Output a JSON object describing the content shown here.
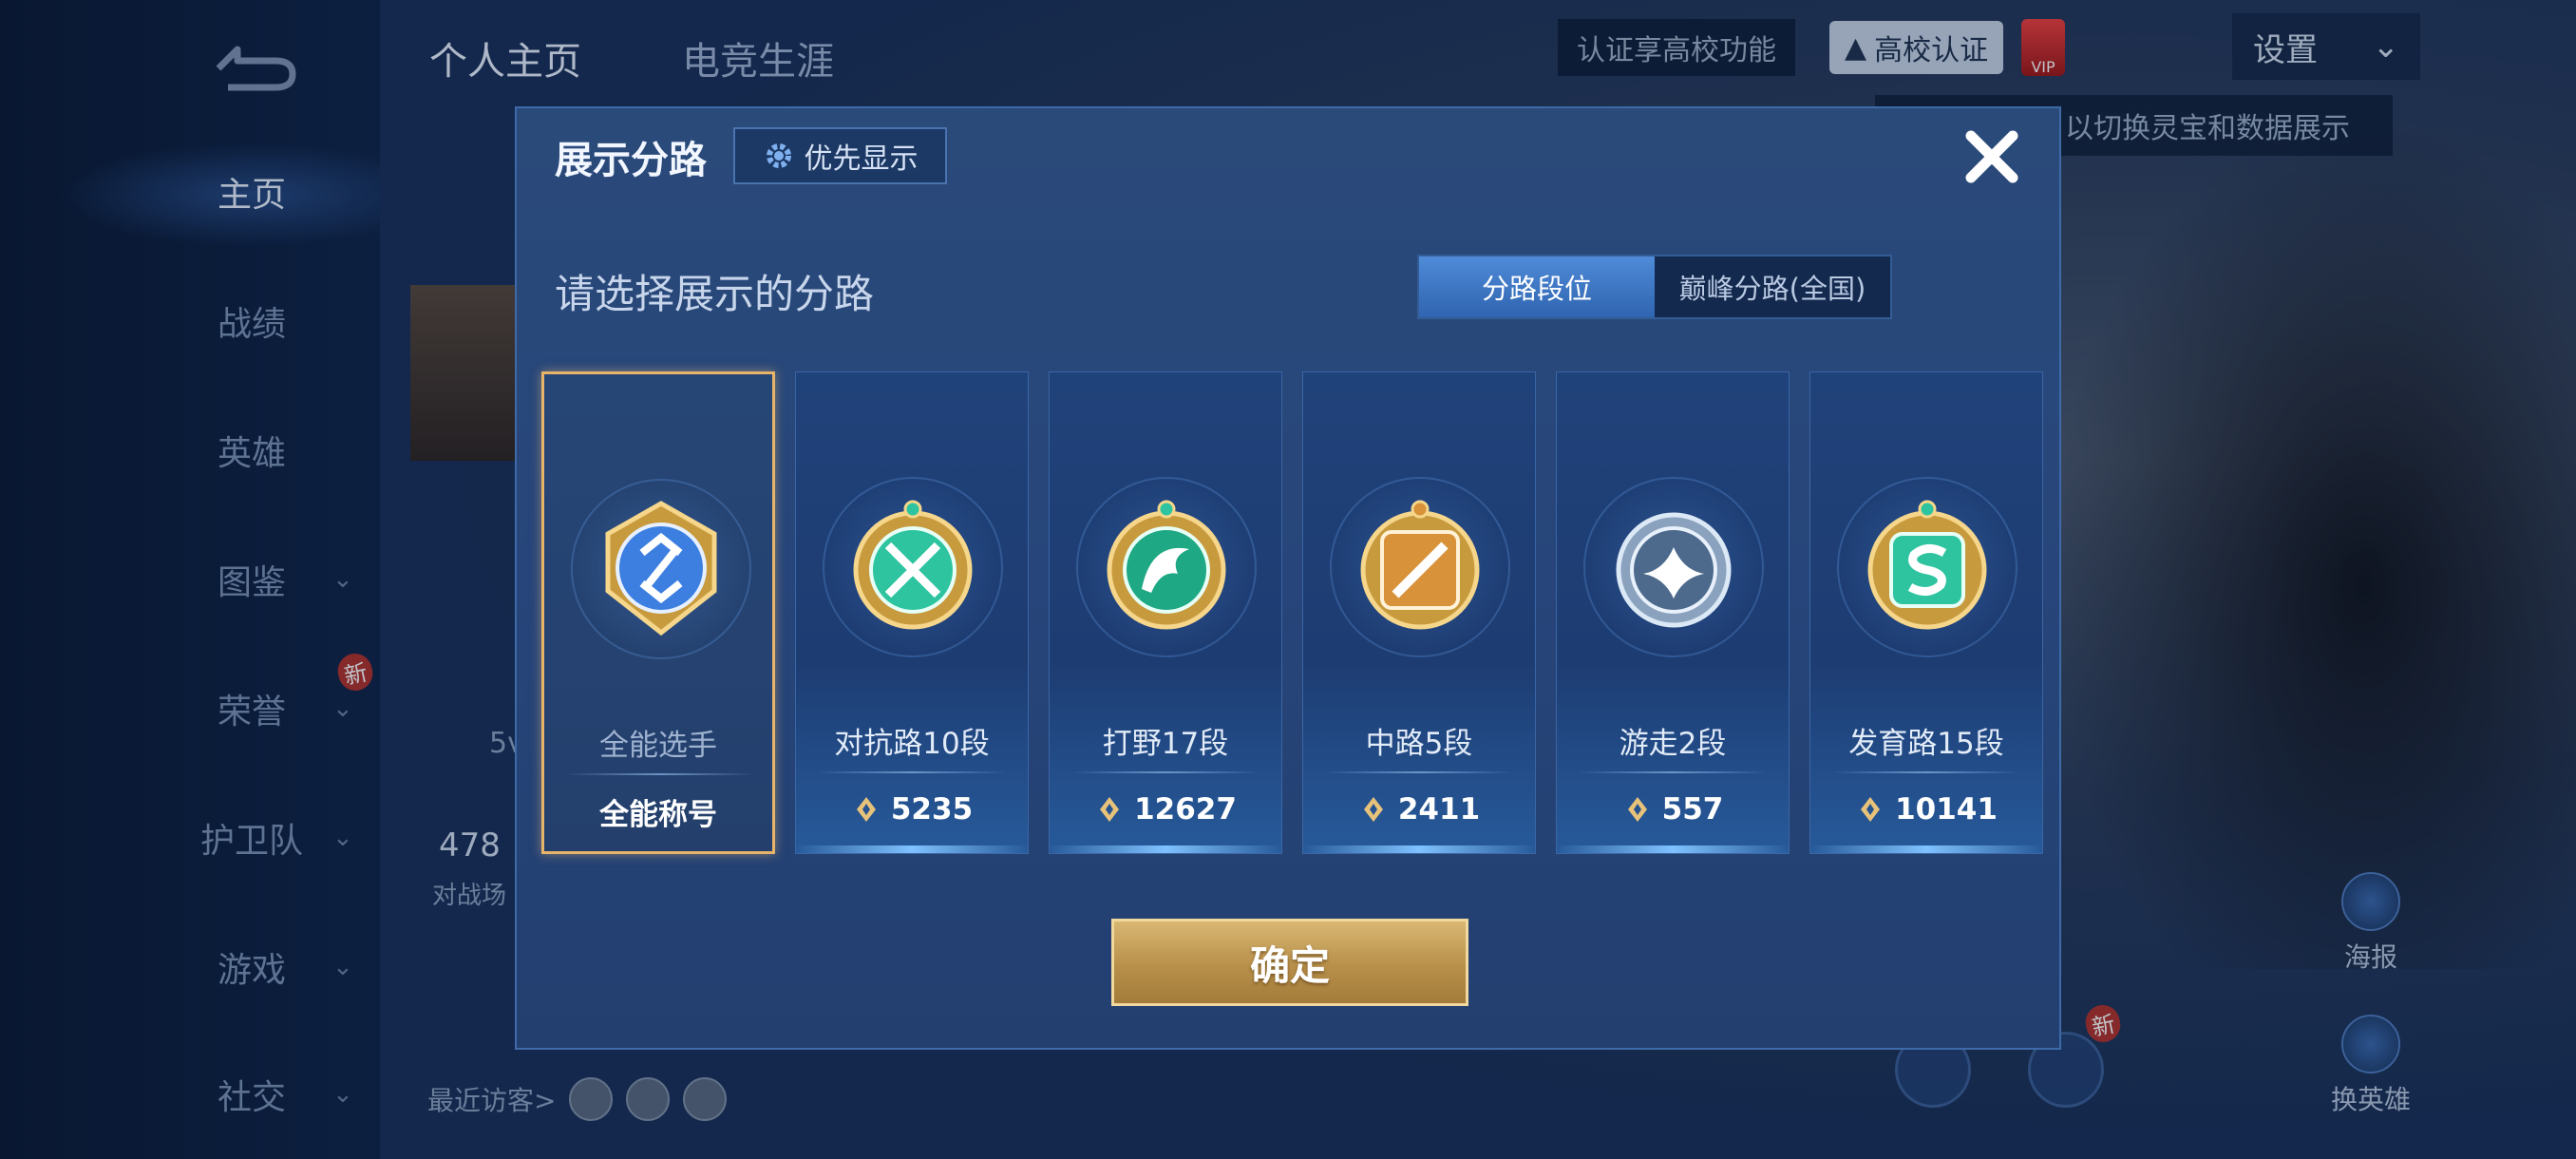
{
  "nav": {
    "items": [
      {
        "label": "主页",
        "active": true
      },
      {
        "label": "战绩"
      },
      {
        "label": "英雄"
      },
      {
        "label": "图鉴",
        "chevron": "⌄"
      },
      {
        "label": "荣誉",
        "chevron": "⌄",
        "badge": "新"
      },
      {
        "label": "护卫队",
        "chevron": "⌄"
      },
      {
        "label": "游戏",
        "chevron": "⌄"
      },
      {
        "label": "社交",
        "chevron": "⌄"
      }
    ]
  },
  "header": {
    "tabs": [
      "个人主页",
      "电竞生涯"
    ],
    "cert_banner": "认证享高校功能",
    "cert_button": "高校认证",
    "vip": "VIP",
    "settings": "设置",
    "tip": "以切换灵宝和数据展示"
  },
  "profile": {
    "stat_value": "478",
    "stat_label": "对战场",
    "recent_visitors": "最近访客>",
    "side_value": "5v"
  },
  "side_buttons": {
    "poster": "海报",
    "switch_hero": "换英雄",
    "new_badge": "新"
  },
  "dialog": {
    "title": "展示分路",
    "priority_button": "优先显示",
    "subtitle": "请选择展示的分路",
    "toggle": {
      "lane_rank": "分路段位",
      "peak_lane": "巅峰分路(全国)"
    },
    "cards": [
      {
        "lane": "全能选手",
        "score": "全能称号",
        "emblem": "all-round-emblem",
        "color": "#3c7fe0",
        "selected": true
      },
      {
        "lane": "对抗路10段",
        "score": "5235",
        "emblem": "clash-lane-emblem",
        "color": "#2ec4a0"
      },
      {
        "lane": "打野17段",
        "score": "12627",
        "emblem": "jungle-emblem",
        "color": "#1fa884"
      },
      {
        "lane": "中路5段",
        "score": "2411",
        "emblem": "mid-lane-emblem",
        "color": "#d8923a"
      },
      {
        "lane": "游走2段",
        "score": "557",
        "emblem": "roam-emblem",
        "color": "#9fb6cf"
      },
      {
        "lane": "发育路15段",
        "score": "10141",
        "emblem": "farm-lane-emblem",
        "color": "#2ec4a0"
      }
    ],
    "confirm": "确定"
  }
}
